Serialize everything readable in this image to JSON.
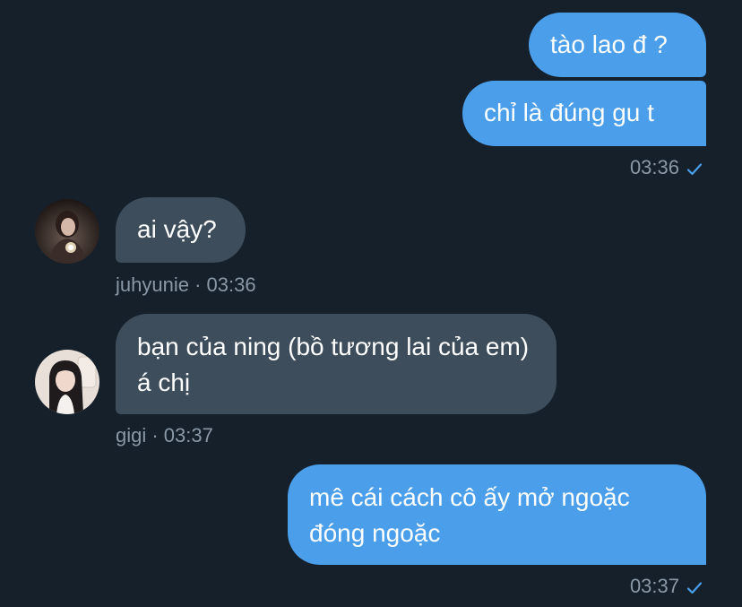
{
  "colors": {
    "background": "#15202b",
    "sent_bubble": "#4a9eea",
    "received_bubble": "#3d4d5c",
    "meta_text": "#8b98a5",
    "check_color": "#4a9eea"
  },
  "messages": [
    {
      "id": "m1",
      "direction": "sent",
      "text": "tào lao đ ?"
    },
    {
      "id": "m2",
      "direction": "sent",
      "text": "chỉ là đúng gu t",
      "time": "03:36",
      "status_icon": "check-icon"
    },
    {
      "id": "m3",
      "direction": "received",
      "avatar_icon": "avatar-juhyunie",
      "text": "ai vậy?",
      "meta": "juhyunie · 03:36"
    },
    {
      "id": "m4",
      "direction": "received",
      "avatar_icon": "avatar-gigi",
      "text": "bạn của ning (bồ tương lai của em) á chị",
      "meta": "gigi · 03:37"
    },
    {
      "id": "m5",
      "direction": "sent",
      "text": "mê cái cách cô ấy mở ngoặc đóng ngoặc",
      "time": "03:37",
      "status_icon": "check-icon"
    }
  ]
}
